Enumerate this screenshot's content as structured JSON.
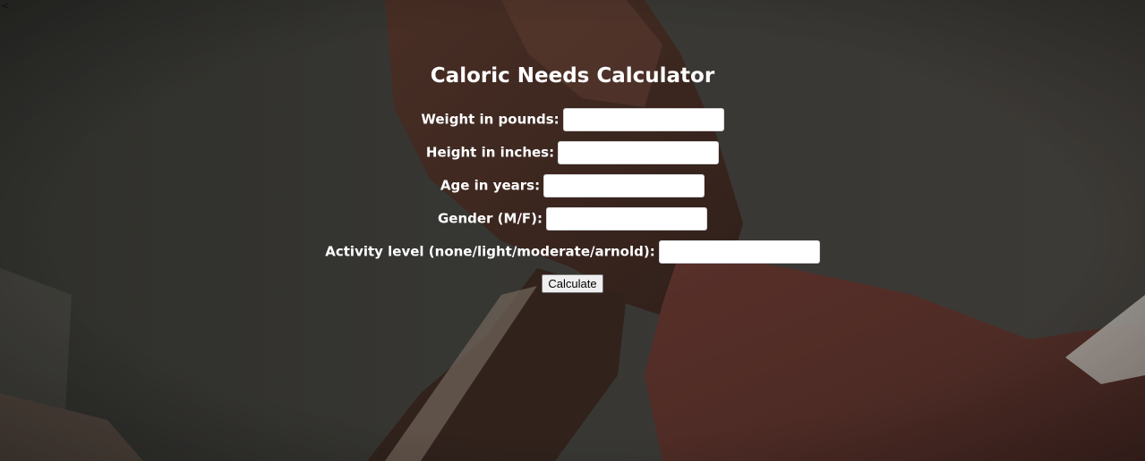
{
  "page": {
    "corner_glyph": "<"
  },
  "form": {
    "title": "Caloric Needs Calculator",
    "fields": [
      {
        "label": "Weight in pounds:",
        "value": ""
      },
      {
        "label": "Height in inches:",
        "value": ""
      },
      {
        "label": "Age in years:",
        "value": ""
      },
      {
        "label": "Gender (M/F):",
        "value": ""
      },
      {
        "label": "Activity level (none/light/moderate/arnold):",
        "value": ""
      }
    ],
    "submit_label": "Calculate"
  },
  "colors": {
    "text": "#ffffff",
    "background": "#3f3f3c",
    "input_background": "#ffffff",
    "button_background": "#efefef"
  }
}
